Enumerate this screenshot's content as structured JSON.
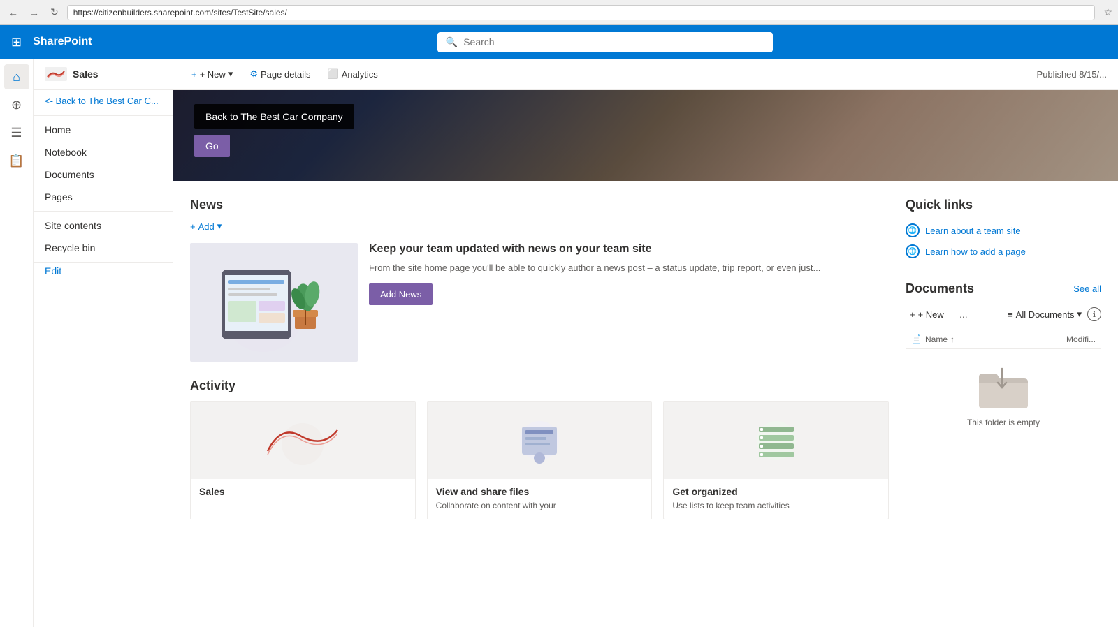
{
  "browser": {
    "url": "https://citizenbuilders.sharepoint.com/sites/TestSite/sales/",
    "back_btn": "←",
    "forward_btn": "→",
    "refresh_btn": "↻"
  },
  "topbar": {
    "waffle_icon": "⊞",
    "app_name": "SharePoint",
    "search_placeholder": "Search"
  },
  "side_icons": [
    {
      "name": "home-icon",
      "glyph": "⌂"
    },
    {
      "name": "globe-icon",
      "glyph": "⊕"
    },
    {
      "name": "pages-icon",
      "glyph": "☰"
    },
    {
      "name": "notes-icon",
      "glyph": "📝"
    }
  ],
  "left_nav": {
    "site_title": "Sales",
    "back_link": "<- Back to The Best Car C...",
    "items": [
      {
        "label": "Home"
      },
      {
        "label": "Notebook"
      },
      {
        "label": "Documents"
      },
      {
        "label": "Pages"
      },
      {
        "label": "Site contents"
      },
      {
        "label": "Recycle bin"
      },
      {
        "label": "Edit"
      }
    ]
  },
  "toolbar": {
    "new_label": "+ New",
    "new_dropdown": "▾",
    "page_details_label": "Page details",
    "analytics_label": "Analytics",
    "published_text": "Published 8/15/..."
  },
  "hero": {
    "tooltip_text": "Back to The Best Car Company",
    "go_button": "Go"
  },
  "news": {
    "section_title": "News",
    "add_label": "+ Add",
    "card_title": "Keep your team updated with news on your team site",
    "card_desc": "From the site home page you'll be able to quickly author a news post – a status update, trip report, or even just...",
    "add_news_btn": "Add News"
  },
  "quick_links": {
    "title": "Quick links",
    "links": [
      {
        "label": "Learn about a team site"
      },
      {
        "label": "Learn how to add a page"
      }
    ]
  },
  "documents": {
    "title": "Documents",
    "see_all": "See all",
    "new_btn": "+ New",
    "more_btn": "...",
    "filter_label": "All Documents",
    "col_name": "Name",
    "col_modified": "Modifi...",
    "empty_text": "This folder is empty"
  },
  "activity": {
    "section_title": "Activity",
    "cards": [
      {
        "title": "Sales",
        "desc": ""
      },
      {
        "title": "View and share files",
        "desc": "Collaborate on content with your"
      },
      {
        "title": "Get organized",
        "desc": "Use lists to keep team activities"
      }
    ]
  }
}
